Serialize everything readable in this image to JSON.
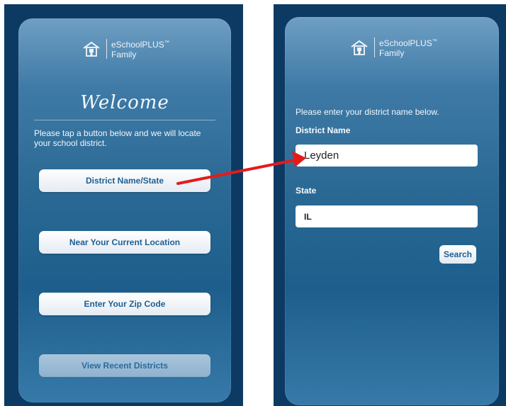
{
  "left_screen": {
    "logo": {
      "line1": "eSchoolPLUS",
      "line2": "Family",
      "tm": "™"
    },
    "welcome": "Welcome",
    "intro": "Please tap a button below and we will locate your school district.",
    "buttons": {
      "district_name_state": "District Name/State",
      "near_location": "Near Your Current Location",
      "zip_code": "Enter Your Zip Code",
      "recent_districts": "View Recent Districts"
    }
  },
  "right_screen": {
    "logo": {
      "line1": "eSchoolPLUS",
      "line2": "Family",
      "tm": "™"
    },
    "prompt": "Please enter your district name below.",
    "district_label": "District Name",
    "district_value": "Leyden",
    "state_label": "State",
    "state_value": "IL",
    "search_label": "Search"
  },
  "colors": {
    "phone_background": "#0c3a63",
    "button_text": "#1f5f93",
    "arrow": "#e41b1b"
  },
  "icons": {
    "logo_mark": "school-house-icon",
    "connector": "red-arrow"
  }
}
